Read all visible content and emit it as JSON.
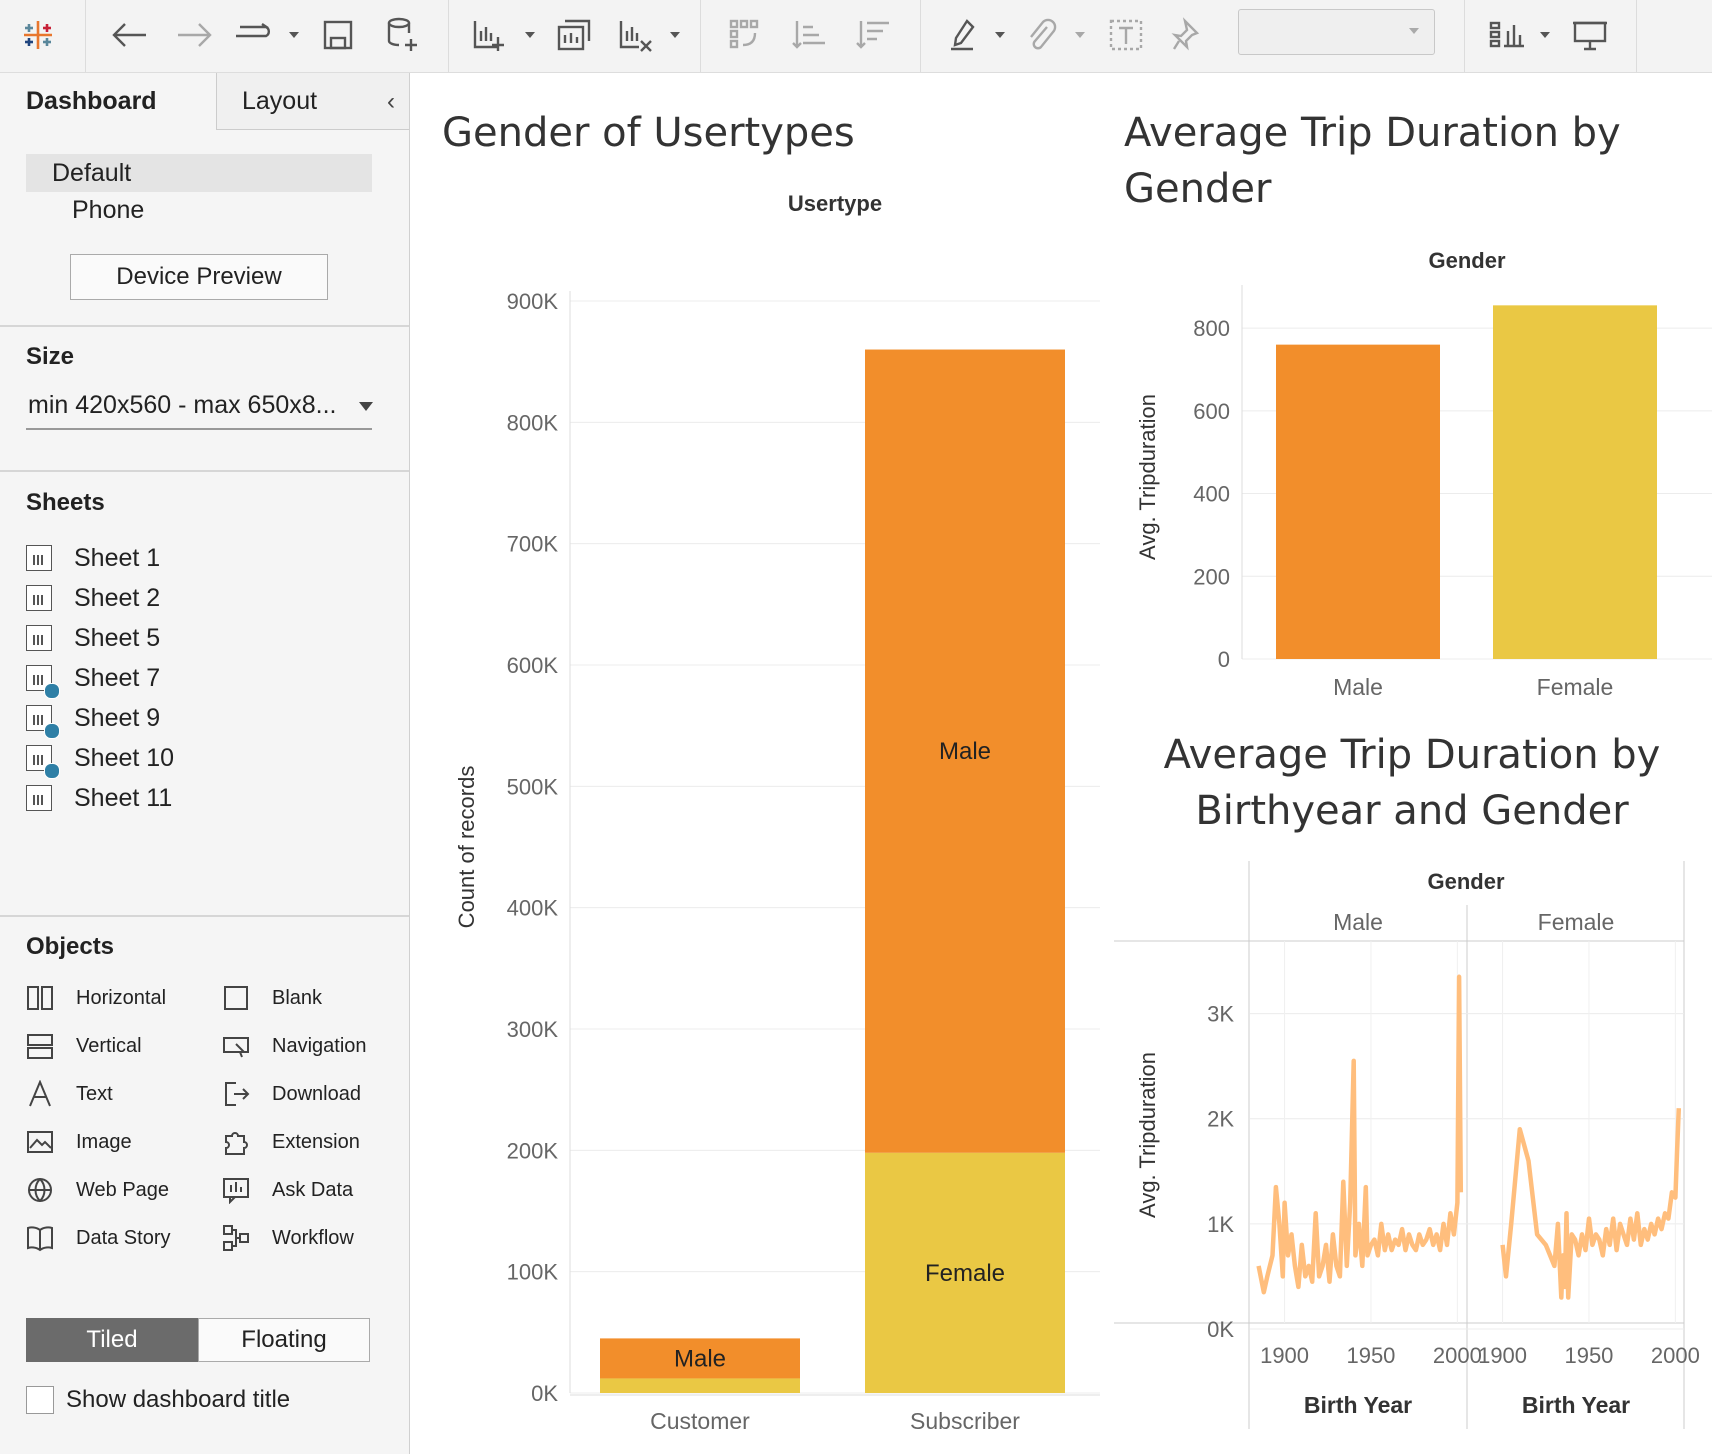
{
  "sidebar": {
    "tabs": {
      "dashboard": "Dashboard",
      "layout": "Layout"
    },
    "devices": {
      "default": "Default",
      "phone": "Phone",
      "preview_button": "Device Preview"
    },
    "size": {
      "title": "Size",
      "value": "min 420x560 - max 650x8..."
    },
    "sheets": {
      "title": "Sheets",
      "items": [
        {
          "label": "Sheet 1",
          "used": false
        },
        {
          "label": "Sheet 2",
          "used": false
        },
        {
          "label": "Sheet 5",
          "used": false
        },
        {
          "label": "Sheet 7",
          "used": true
        },
        {
          "label": "Sheet 9",
          "used": true
        },
        {
          "label": "Sheet 10",
          "used": true
        },
        {
          "label": "Sheet 11",
          "used": false
        }
      ]
    },
    "objects": {
      "title": "Objects",
      "items": [
        {
          "label": "Horizontal",
          "icon": "horizontal-icon"
        },
        {
          "label": "Blank",
          "icon": "blank-icon"
        },
        {
          "label": "Vertical",
          "icon": "vertical-icon"
        },
        {
          "label": "Navigation",
          "icon": "navigation-icon"
        },
        {
          "label": "Text",
          "icon": "text-icon"
        },
        {
          "label": "Download",
          "icon": "download-icon"
        },
        {
          "label": "Image",
          "icon": "image-icon"
        },
        {
          "label": "Extension",
          "icon": "extension-icon"
        },
        {
          "label": "Web Page",
          "icon": "globe-icon"
        },
        {
          "label": "Ask Data",
          "icon": "ask-data-icon"
        },
        {
          "label": "Data Story",
          "icon": "book-icon"
        },
        {
          "label": "Workflow",
          "icon": "workflow-icon"
        }
      ]
    },
    "mode": {
      "tiled": "Tiled",
      "floating": "Floating",
      "selected": "Tiled"
    },
    "show_title": {
      "label": "Show dashboard title",
      "checked": false
    }
  },
  "dashboard": {
    "titles": {
      "usertype": "Gender of Usertypes",
      "gender": [
        "Average Trip Duration by",
        "Gender"
      ],
      "birthyear": [
        "Average Trip Duration by",
        "Birthyear and Gender"
      ]
    }
  },
  "colors": {
    "male": "#F28E2B",
    "female": "#EAC844",
    "line": "#FFBE7D"
  },
  "chart_data": [
    {
      "type": "bar",
      "stacked": true,
      "header": "Usertype",
      "categories": [
        "Customer",
        "Subscriber"
      ],
      "ylabel": "Count of records",
      "ylim": [
        0,
        900000
      ],
      "yticks": [
        "0K",
        "100K",
        "200K",
        "300K",
        "400K",
        "500K",
        "600K",
        "700K",
        "800K",
        "900K"
      ],
      "series": [
        {
          "name": "Female",
          "values": [
            12000,
            198000
          ]
        },
        {
          "name": "Male",
          "values": [
            33000,
            662000
          ]
        }
      ],
      "segment_labels": [
        {
          "category": "Customer",
          "series": "Male",
          "text": "Male"
        },
        {
          "category": "Subscriber",
          "series": "Male",
          "text": "Male"
        },
        {
          "category": "Subscriber",
          "series": "Female",
          "text": "Female"
        }
      ]
    },
    {
      "type": "bar",
      "header": "Gender",
      "categories": [
        "Male",
        "Female"
      ],
      "values": [
        760,
        855
      ],
      "ylabel": "Avg. Tripduration",
      "ylim": [
        0,
        880
      ],
      "yticks": [
        0,
        200,
        400,
        600,
        800
      ]
    },
    {
      "type": "line",
      "header": "Gender",
      "panels": [
        {
          "name": "Male",
          "x": [
            1885,
            1888,
            1890,
            1893,
            1895,
            1897,
            1899,
            1900,
            1902,
            1904,
            1906,
            1908,
            1910,
            1912,
            1914,
            1916,
            1918,
            1920,
            1922,
            1924,
            1926,
            1928,
            1930,
            1932,
            1934,
            1936,
            1938,
            1940,
            1941,
            1943,
            1945,
            1947,
            1948,
            1950,
            1952,
            1954,
            1956,
            1958,
            1960,
            1962,
            1964,
            1966,
            1968,
            1970,
            1972,
            1974,
            1976,
            1978,
            1980,
            1982,
            1984,
            1986,
            1988,
            1990,
            1992,
            1994,
            1996,
            1998,
            2000,
            2001,
            2002
          ],
          "y": [
            600,
            350,
            500,
            700,
            1350,
            1000,
            500,
            1200,
            700,
            900,
            600,
            400,
            800,
            500,
            600,
            450,
            1100,
            500,
            600,
            800,
            450,
            900,
            600,
            500,
            1400,
            600,
            1200,
            2550,
            700,
            1000,
            600,
            1350,
            700,
            800,
            850,
            700,
            1000,
            750,
            900,
            750,
            850,
            800,
            950,
            750,
            900,
            800,
            750,
            900,
            800,
            850,
            950,
            800,
            900,
            750,
            1000,
            800,
            1100,
            900,
            1200,
            3350,
            1300
          ]
        },
        {
          "name": "Female",
          "x": [
            1900,
            1902,
            1905,
            1910,
            1915,
            1920,
            1925,
            1930,
            1932,
            1934,
            1935,
            1936,
            1937,
            1938,
            1940,
            1942,
            1944,
            1946,
            1948,
            1950,
            1952,
            1954,
            1956,
            1958,
            1960,
            1962,
            1964,
            1966,
            1968,
            1970,
            1972,
            1974,
            1976,
            1978,
            1980,
            1982,
            1984,
            1986,
            1988,
            1990,
            1992,
            1994,
            1996,
            1998,
            2000,
            2001,
            2002
          ],
          "y": [
            800,
            500,
            1000,
            1900,
            1600,
            900,
            800,
            600,
            1000,
            300,
            700,
            400,
            1100,
            300,
            900,
            850,
            700,
            900,
            750,
            1050,
            800,
            900,
            850,
            700,
            950,
            800,
            1050,
            750,
            1000,
            900,
            800,
            1050,
            850,
            1100,
            800,
            950,
            850,
            1000,
            900,
            1050,
            950,
            1100,
            1050,
            1300,
            1250,
            1700,
            2100
          ]
        }
      ],
      "xlabel": "Birth Year",
      "xticks": [
        1900,
        1950,
        2000
      ],
      "xlim": [
        1880,
        2005
      ],
      "ylabel": "Avg. Tripduration",
      "ylim": [
        0,
        3500
      ],
      "yticks": [
        "0K",
        "1K",
        "2K",
        "3K"
      ]
    }
  ]
}
